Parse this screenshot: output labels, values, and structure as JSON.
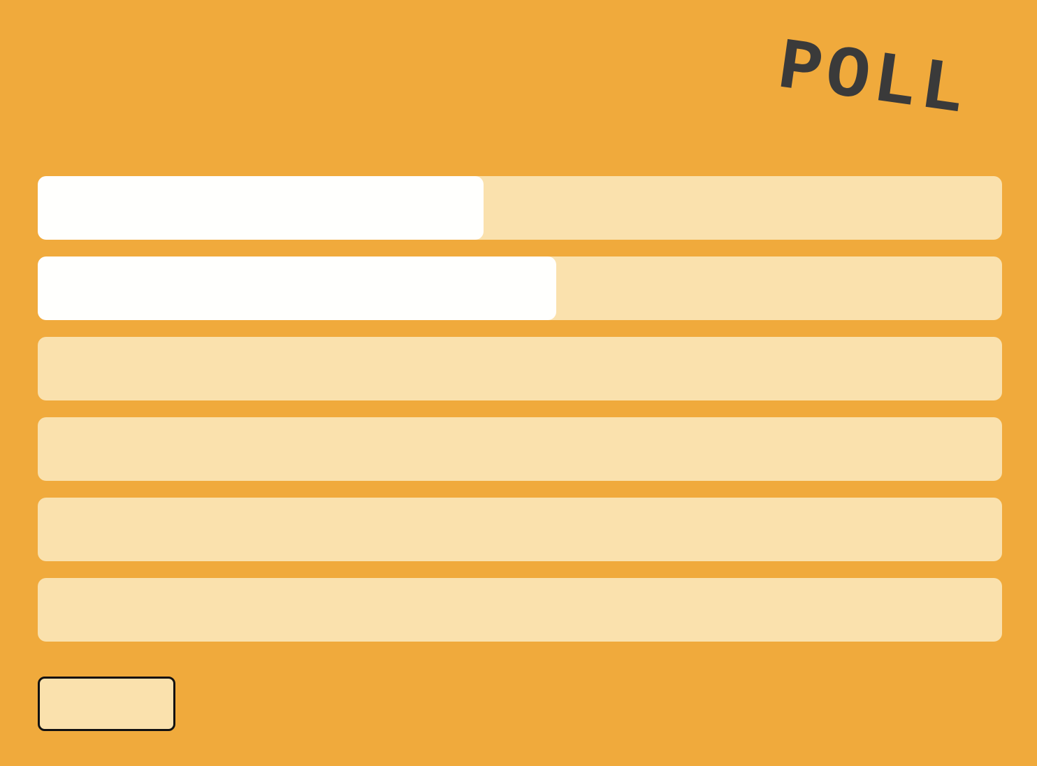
{
  "poll": {
    "title": "POLL",
    "options": [
      {
        "label": "",
        "fill_fraction": 0.462
      },
      {
        "label": "",
        "fill_fraction": 0.538
      },
      {
        "label": "",
        "fill_fraction": 0
      },
      {
        "label": "",
        "fill_fraction": 0
      },
      {
        "label": "",
        "fill_fraction": 0
      },
      {
        "label": "",
        "fill_fraction": 0
      }
    ],
    "submit_label": ""
  },
  "colors": {
    "background": "#f0aa3c",
    "option_track": "#fae1ad",
    "option_fill": "#fffffd",
    "title_text": "#3a3a3a",
    "button_border": "#111111"
  }
}
